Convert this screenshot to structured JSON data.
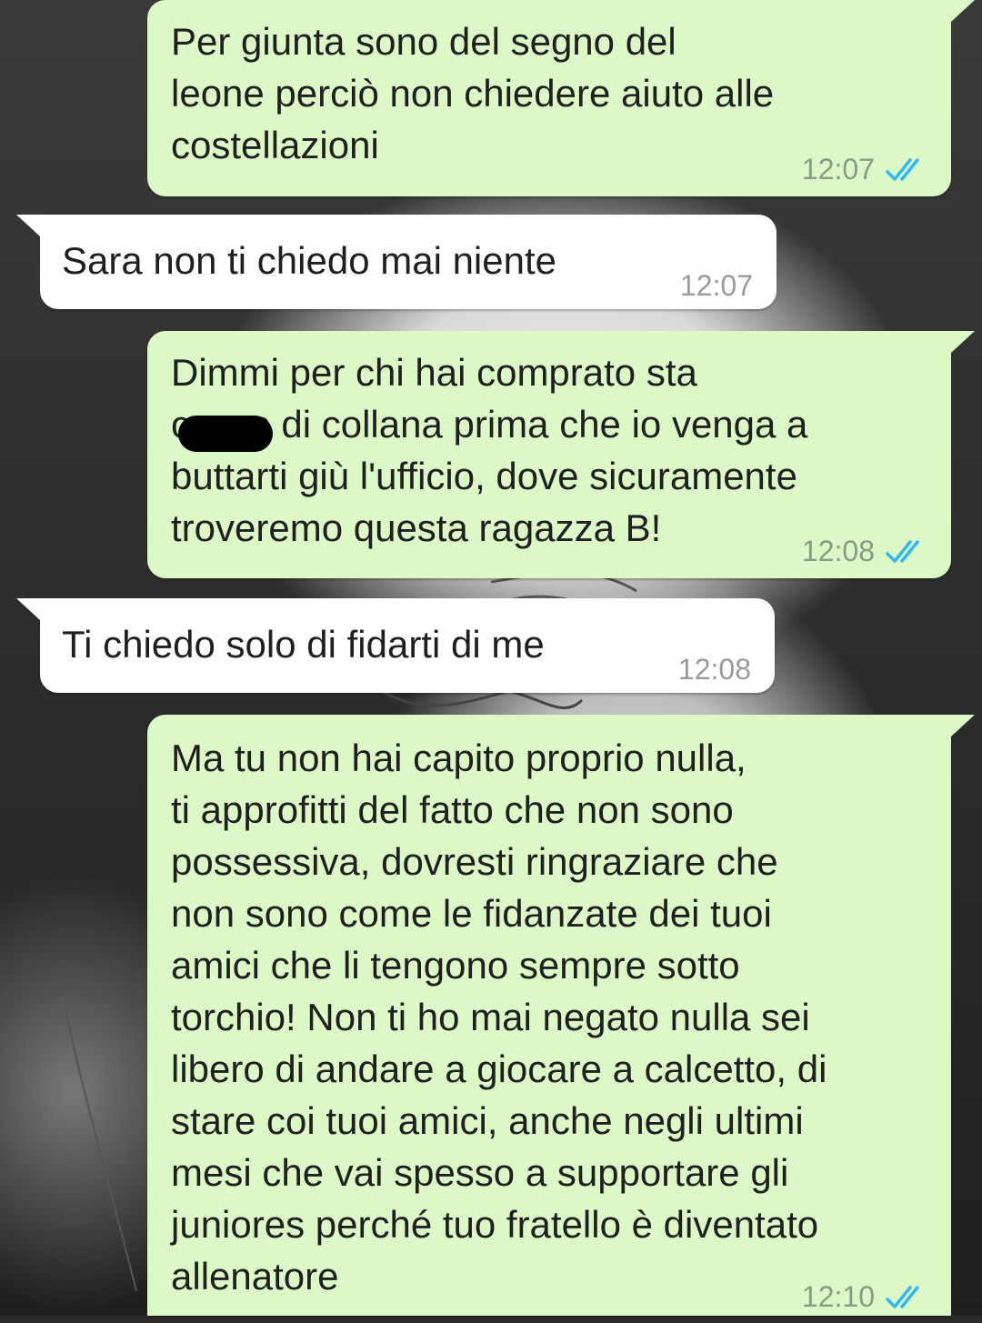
{
  "conversation": {
    "messages": [
      {
        "direction": "outgoing",
        "text": "Per giunta sono del segno del\nleone perciò non chiedere aiuto alle\ncostellazioni",
        "time": "12:07",
        "status": "read",
        "status_icon": "double-check-icon"
      },
      {
        "direction": "incoming",
        "text": "Sara non ti chiedo mai niente",
        "time": "12:07"
      },
      {
        "direction": "outgoing",
        "text": "Dimmi per chi hai comprato sta\ncazzo di collana prima che io venga a\nbuttarti giù l'ufficio, dove sicuramente\ntroveremo questa ragazza B!",
        "time": "12:08",
        "status": "read",
        "status_icon": "double-check-icon",
        "redacted_word": true
      },
      {
        "direction": "incoming",
        "text": "Ti chiedo solo di fidarti di me",
        "time": "12:08"
      },
      {
        "direction": "outgoing",
        "text": "Ma tu non hai capito proprio nulla,\nti approfitti del fatto che non sono\npossessiva, dovresti ringraziare che\nnon sono come le fidanzate dei tuoi\namici che li tengono sempre sotto\ntorchio! Non ti ho mai negato nulla sei\nlibero di andare a giocare a calcetto, di\nstare coi tuoi amici, anche negli ultimi\nmesi che vai spesso a supportare gli\njuniores perché tuo fratello è diventato\nallenatore",
        "time": "12:10",
        "status": "read",
        "status_icon": "double-check-icon"
      }
    ]
  },
  "colors": {
    "outgoing_bubble": "#dcf8c6",
    "incoming_bubble": "#ffffff",
    "read_tick": "#34b7f1",
    "text": "#1f1f1f"
  }
}
